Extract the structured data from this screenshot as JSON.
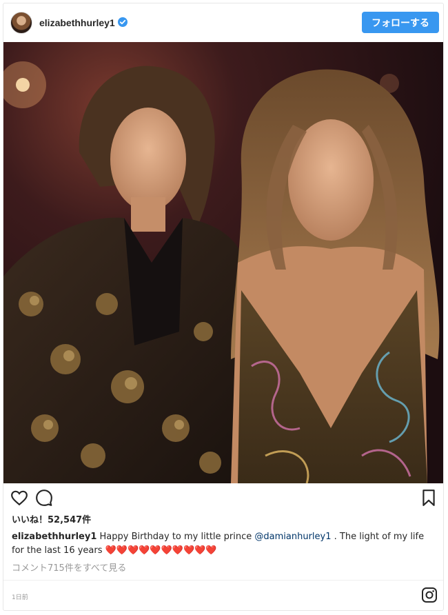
{
  "post": {
    "username": "elizabethhurley1",
    "follow_label": "フォローする",
    "likes_text": "いいね！52,547件",
    "caption": {
      "user": "elizabethhurley1",
      "text_before": " Happy Birthday to my little prince ",
      "mention": "@damianhurley1",
      "text_after": " . The light of my life for the last 16 years ❤️❤️❤️❤️❤️❤️❤️❤️❤️❤️"
    },
    "comments_link": "コメント715件をすべて見る",
    "timestamp": "1日前"
  },
  "colors": {
    "accent": "#3897f0",
    "verified": "#3897f0",
    "mention": "#003569",
    "muted": "#999999"
  },
  "icons": [
    "verified-badge-icon",
    "heart-icon",
    "comment-icon",
    "bookmark-icon",
    "instagram-logo-icon"
  ]
}
